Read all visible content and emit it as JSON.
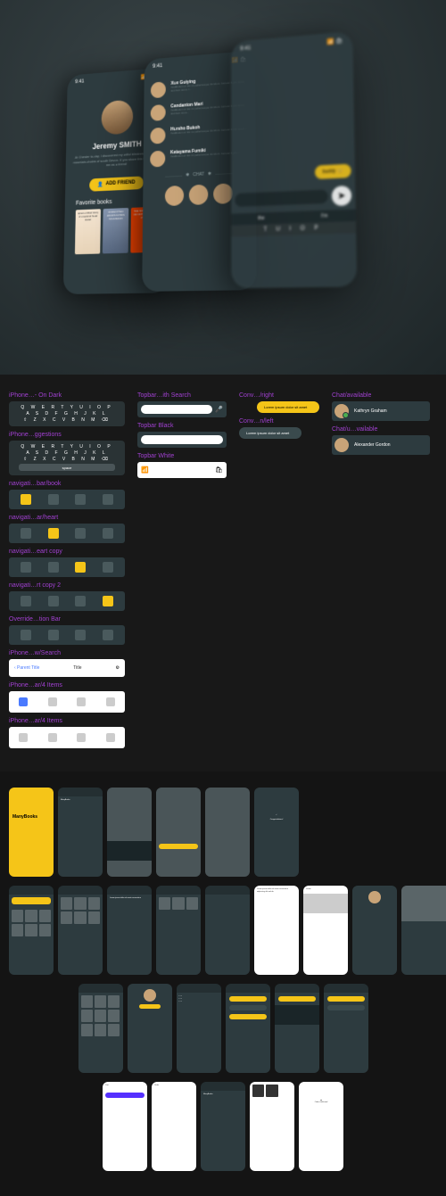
{
  "hero": {
    "time": "9:41",
    "profile": {
      "name": "Jeremy SMITH",
      "bio": "At Chester to-day, I discovered my wilful blindness to the old mountain-chains of south Devon. If you share this interest, add me as a friend!",
      "add_friend": "ADD FRIEND",
      "fav_title": "Favorite books",
      "books": [
        "apiens\nA Brief\nistory of\numankind\nNoah Harari",
        "FORGOTTEN\nHOURS\nKATRIN SCHUMANN",
        "THE SUBTLE ART OF NOT GIVING A F*CK"
      ]
    },
    "contacts": {
      "items": [
        {
          "name": "Xue Guiying",
          "sub": "Vestibulum et nisi mi pellentesque tincidunt. Aenean ligula quam, tincidunt nisi a, f..."
        },
        {
          "name": "Candanton Mari",
          "sub": "Vestibulum et nisi mi pellentesque tincidunt. Aenean ligula quam, tincidunt nisi a..."
        },
        {
          "name": "Hursho Bukoh",
          "sub": "Vestibulum et nisi mi pellentesque tincidunt. Aenean ligula quam..."
        },
        {
          "name": "Katayama Fumiki",
          "sub": "Vestibulum et nisi mi pellentesque tincidunt. Aenean ligula..."
        }
      ],
      "chat_label": "CHAT"
    },
    "chat": {
      "bubble": "buddy 😊",
      "suggestions": [
        "the",
        "I'm"
      ],
      "keys": "T U I O P"
    }
  },
  "components": {
    "col1": [
      "iPhone…- On Dark",
      "iPhone…ggestions",
      "navigati…bar/book",
      "navigati…ar/heart",
      "navigati…eart copy",
      "navigati…rt copy 2",
      "Override…tion Bar",
      "iPhone…w/Search",
      "iPhone…ar/4 Items",
      "iPhone…ar/4 Items"
    ],
    "col2": [
      "Topbar…ith Search",
      "Topbar Black",
      "Topbar White"
    ],
    "col3": [
      "Conv…/right",
      "Conv…n/left"
    ],
    "col4": [
      "Chat/available",
      "Chat/u…vailable"
    ],
    "nav_title": "Title",
    "nav_back": "‹ Parent Title",
    "kbd_rows": [
      "Q W E R T Y U I O P",
      "A S D F G H J K L",
      "⇧ Z X C V B N M ⌫"
    ],
    "kbd_space": "space",
    "contact1": "Kathryn Graham",
    "contact2": "Alexander Gordon"
  },
  "screens": {
    "brand": "ManyBooks",
    "tagline": "Explore together",
    "congrats": "Congratulations!"
  }
}
